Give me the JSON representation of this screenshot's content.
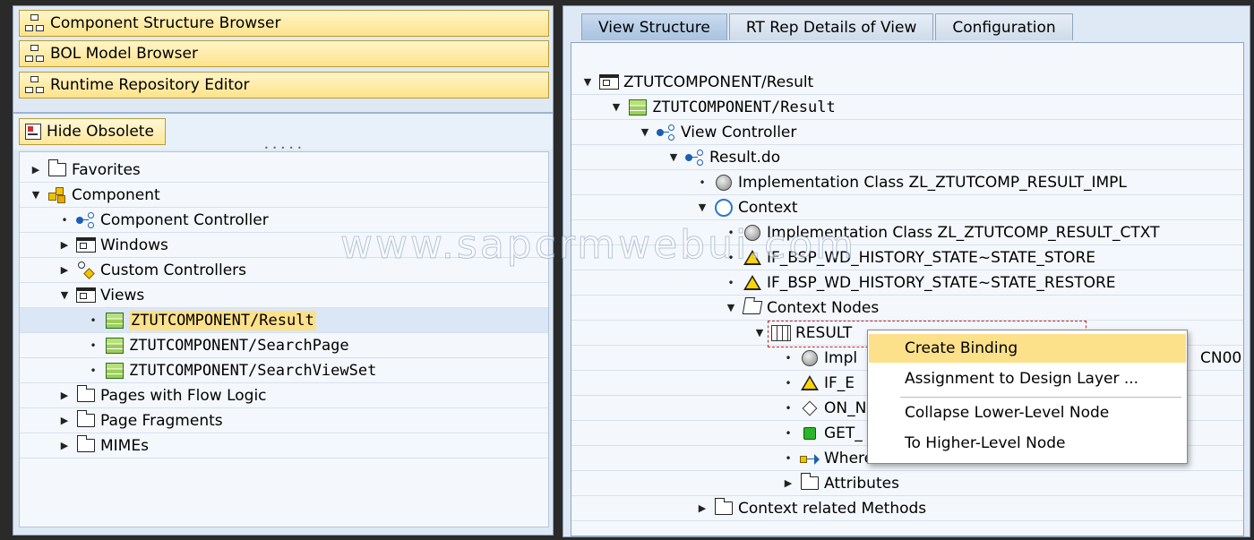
{
  "left_nav": {
    "buttons": [
      "Component Structure Browser",
      "BOL Model Browser",
      "Runtime Repository Editor"
    ],
    "hide_obsolete": "Hide Obsolete"
  },
  "left_tree": [
    {
      "label": "Favorites",
      "icon": "folder-icon",
      "state": "collapsed",
      "level": 0
    },
    {
      "label": "Component",
      "icon": "component-icon",
      "state": "expanded",
      "level": 0
    },
    {
      "label": "Component Controller",
      "icon": "controller-icon",
      "state": "leaf",
      "level": 1
    },
    {
      "label": "Windows",
      "icon": "window-icon",
      "state": "collapsed",
      "level": 1
    },
    {
      "label": "Custom Controllers",
      "icon": "custom-controller-icon",
      "state": "collapsed",
      "level": 1
    },
    {
      "label": "Views",
      "icon": "window-icon",
      "state": "expanded",
      "level": 1
    },
    {
      "label": "ZTUTCOMPONENT/Result",
      "icon": "view-icon",
      "state": "leaf",
      "level": 2,
      "selected": true
    },
    {
      "label": "ZTUTCOMPONENT/SearchPage",
      "icon": "view-icon",
      "state": "leaf",
      "level": 2
    },
    {
      "label": "ZTUTCOMPONENT/SearchViewSet",
      "icon": "view-icon",
      "state": "leaf",
      "level": 2
    },
    {
      "label": "Pages with Flow Logic",
      "icon": "folder-icon",
      "state": "collapsed",
      "level": 1
    },
    {
      "label": "Page Fragments",
      "icon": "folder-icon",
      "state": "collapsed",
      "level": 1
    },
    {
      "label": "MIMEs",
      "icon": "folder-icon",
      "state": "collapsed",
      "level": 1
    }
  ],
  "tabs": [
    "View Structure",
    "RT Rep Details of View",
    "Configuration"
  ],
  "right_tree": [
    {
      "label": "ZTUTCOMPONENT/Result",
      "icon": "window-icon",
      "state": "expanded",
      "level": 0,
      "mono": false
    },
    {
      "label": "ZTUTCOMPONENT/Result",
      "icon": "view-icon",
      "state": "expanded",
      "level": 1,
      "mono": true
    },
    {
      "label": "View Controller",
      "icon": "controller-icon",
      "state": "expanded",
      "level": 2
    },
    {
      "label": "Result.do",
      "icon": "controller-icon",
      "state": "expanded",
      "level": 3
    },
    {
      "label": "Implementation Class ZL_ZTUTCOMP_RESULT_IMPL",
      "icon": "class-icon",
      "state": "leaf",
      "level": 4
    },
    {
      "label": "Context",
      "icon": "context-icon",
      "state": "expanded",
      "level": 4
    },
    {
      "label": "Implementation Class ZL_ZTUTCOMP_RESULT_CTXT",
      "icon": "class-icon",
      "state": "leaf",
      "level": 5
    },
    {
      "label": "IF_BSP_WD_HISTORY_STATE~STATE_STORE",
      "icon": "warning-icon",
      "state": "leaf",
      "level": 5
    },
    {
      "label": "IF_BSP_WD_HISTORY_STATE~STATE_RESTORE",
      "icon": "warning-icon",
      "state": "leaf",
      "level": 5
    },
    {
      "label": "Context Nodes",
      "icon": "folder-open-icon",
      "state": "expanded",
      "level": 5
    },
    {
      "label": "RESULT",
      "icon": "table-icon",
      "state": "expanded",
      "level": 6
    },
    {
      "label": "Impl",
      "icon": "class-icon",
      "state": "leaf",
      "level": 7,
      "suffix": "CN00"
    },
    {
      "label": "IF_E",
      "icon": "warning-icon",
      "state": "leaf",
      "level": 7
    },
    {
      "label": "ON_N",
      "icon": "diamond-icon",
      "state": "leaf",
      "level": 7
    },
    {
      "label": "GET_",
      "icon": "green-square-icon",
      "state": "leaf",
      "level": 7
    },
    {
      "label": "Where-Used",
      "icon": "where-used-icon",
      "state": "leaf",
      "level": 7
    },
    {
      "label": "Attributes",
      "icon": "folder-icon",
      "state": "collapsed",
      "level": 7
    },
    {
      "label": "Context related Methods",
      "icon": "folder-icon",
      "state": "collapsed",
      "level": 4
    }
  ],
  "context_menu": {
    "items": [
      {
        "label": "Create Binding",
        "selected": true
      },
      {
        "label": "Assignment to Design Layer ..."
      },
      {
        "label": "Collapse Lower-Level Node"
      },
      {
        "label": "To Higher-Level Node"
      }
    ]
  },
  "watermark": "www.sapcrmwebui.com"
}
